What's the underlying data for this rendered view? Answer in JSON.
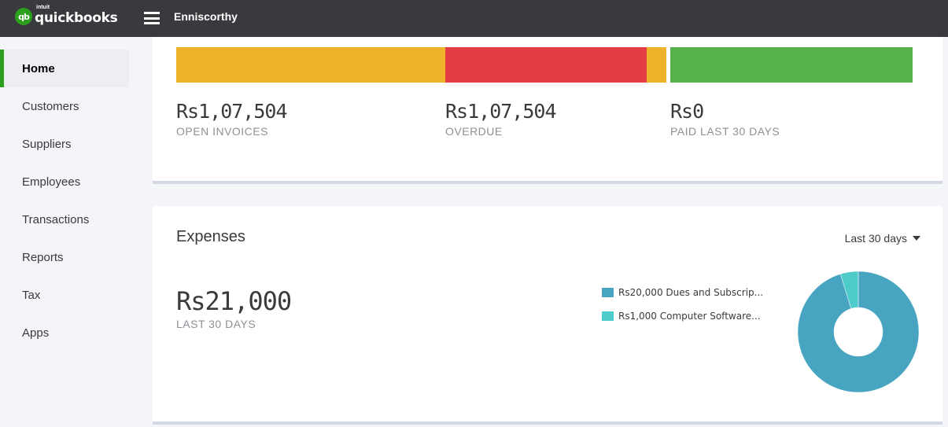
{
  "app": {
    "logo_small": "intuit",
    "logo_main": "quickbooks",
    "logo_badge": "qb",
    "company_name": "Enniscorthy",
    "brand_color": "#2ca01c"
  },
  "sidebar": {
    "items": [
      {
        "label": "Home",
        "active": true
      },
      {
        "label": "Customers",
        "active": false
      },
      {
        "label": "Suppliers",
        "active": false
      },
      {
        "label": "Employees",
        "active": false
      },
      {
        "label": "Transactions",
        "active": false
      },
      {
        "label": "Reports",
        "active": false
      },
      {
        "label": "Tax",
        "active": false
      },
      {
        "label": "Apps",
        "active": false
      }
    ]
  },
  "invoices": {
    "bar_colors": {
      "open": "#eeb32a",
      "overdue": "#e33d45",
      "paid": "#56b34b"
    },
    "metrics": [
      {
        "value": "Rs1,07,504",
        "label": "OPEN INVOICES"
      },
      {
        "value": "Rs1,07,504",
        "label": "OVERDUE"
      },
      {
        "value": "Rs0",
        "label": "PAID LAST 30 DAYS"
      }
    ]
  },
  "expenses": {
    "title": "Expenses",
    "range_selected": "Last 30 days",
    "total": "Rs21,000",
    "total_label": "LAST 30 DAYS",
    "legend": [
      {
        "label": "Rs20,000 Dues and Subscrip...",
        "color": "#48a5c2"
      },
      {
        "label": "Rs1,000 Computer Software...",
        "color": "#4ecbcb"
      }
    ]
  },
  "chart_data": {
    "type": "pie",
    "donut": true,
    "title": "Expenses",
    "categories": [
      "Dues and Subscriptions",
      "Computer Software"
    ],
    "values": [
      20000,
      1000
    ],
    "colors": [
      "#48a5c2",
      "#4ecbcb"
    ],
    "legend_position": "left"
  }
}
